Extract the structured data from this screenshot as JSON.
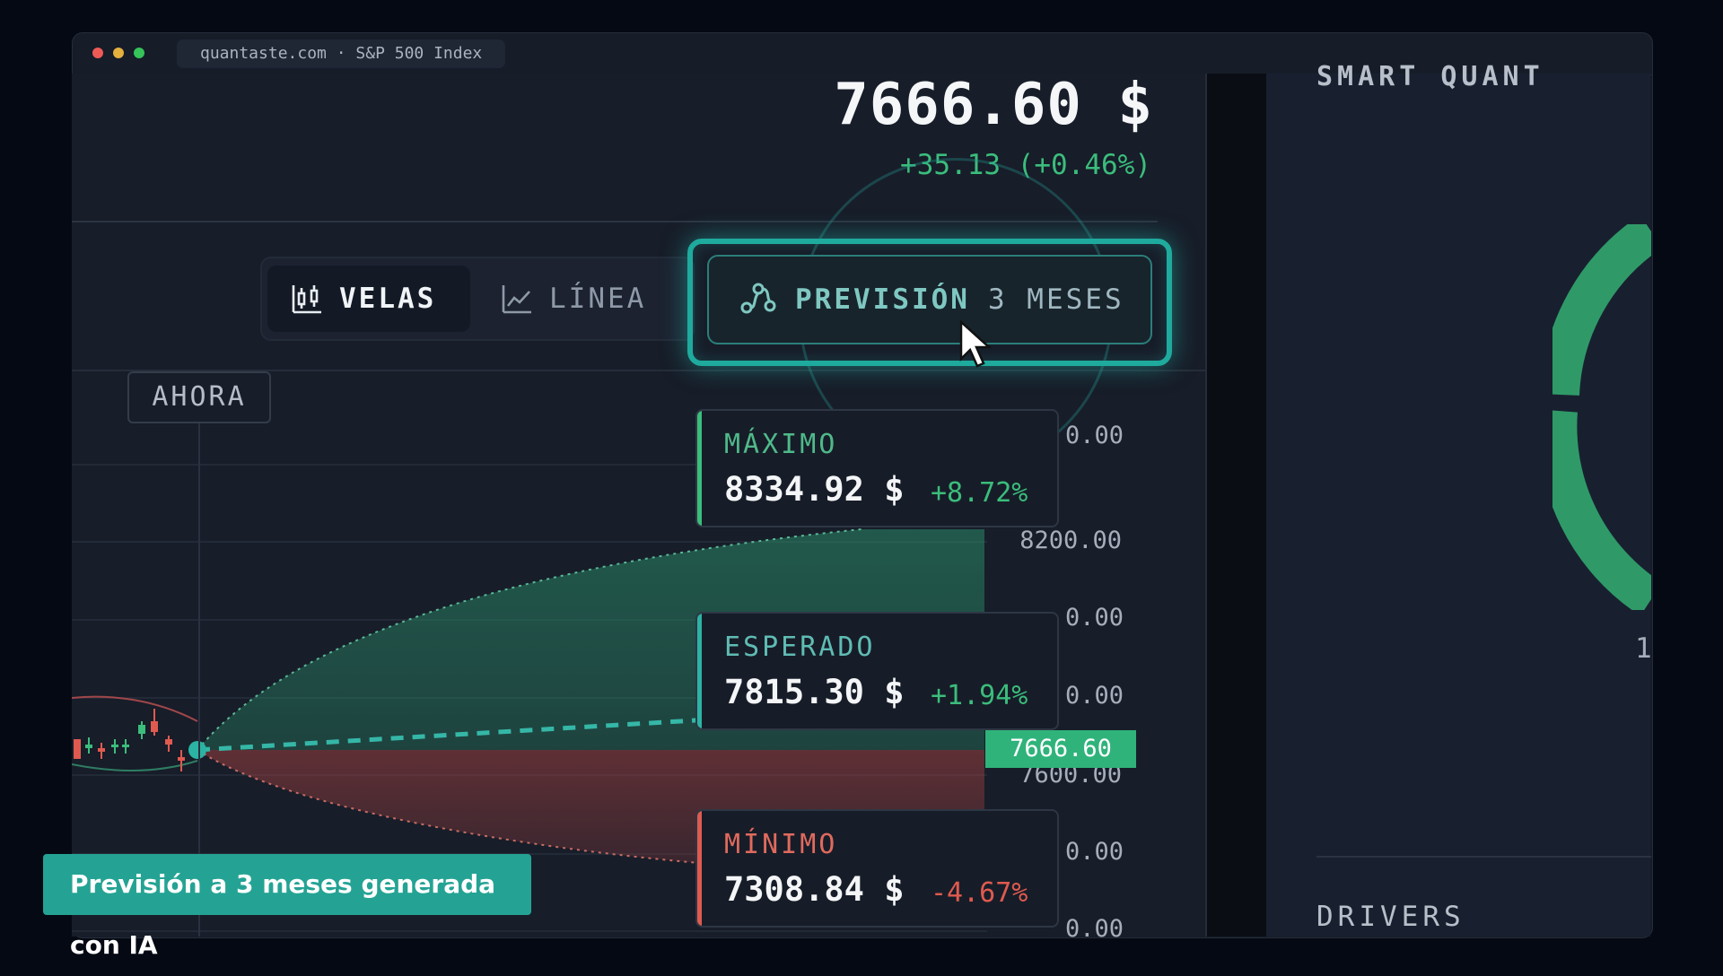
{
  "window": {
    "url_title": "quantaste.com · S&P 500 Index"
  },
  "quote": {
    "price": "7666.60 $",
    "change": "+35.13 (+0.46%)"
  },
  "chart_tabs": {
    "velas": "VELAS",
    "linea": "LÍNEA"
  },
  "forecast_button": {
    "label_main": "PREVISIÓN",
    "label_rest": "3 MESES"
  },
  "now_marker": "AHORA",
  "y_axis_labels": [
    "8200.00",
    "7600.00"
  ],
  "current_price_tag": "7666.60",
  "forecast_cards": {
    "max": {
      "label": "MÁXIMO",
      "value": "8334.92 $",
      "pct": "+8.72%"
    },
    "expected": {
      "label": "ESPERADO",
      "value": "7815.30 $",
      "pct": "+1.94%"
    },
    "min": {
      "label": "MÍNIMO",
      "value": "7308.84 $",
      "pct": "-4.67%"
    }
  },
  "caption": "Previsión a 3 meses generada con IA",
  "side_panel": {
    "title": "SMART QUANT",
    "drivers": "DRIVERS",
    "partial_number": "1"
  },
  "colors": {
    "accent_teal": "#1faa9e",
    "positive": "#3bbd7c",
    "negative": "#e05a4f",
    "background": "#171d29"
  },
  "icons": {
    "velas": "candlestick-chart-icon",
    "linea": "line-chart-icon",
    "forecast": "forecast-nodes-icon",
    "cursor": "mouse-pointer-icon"
  }
}
